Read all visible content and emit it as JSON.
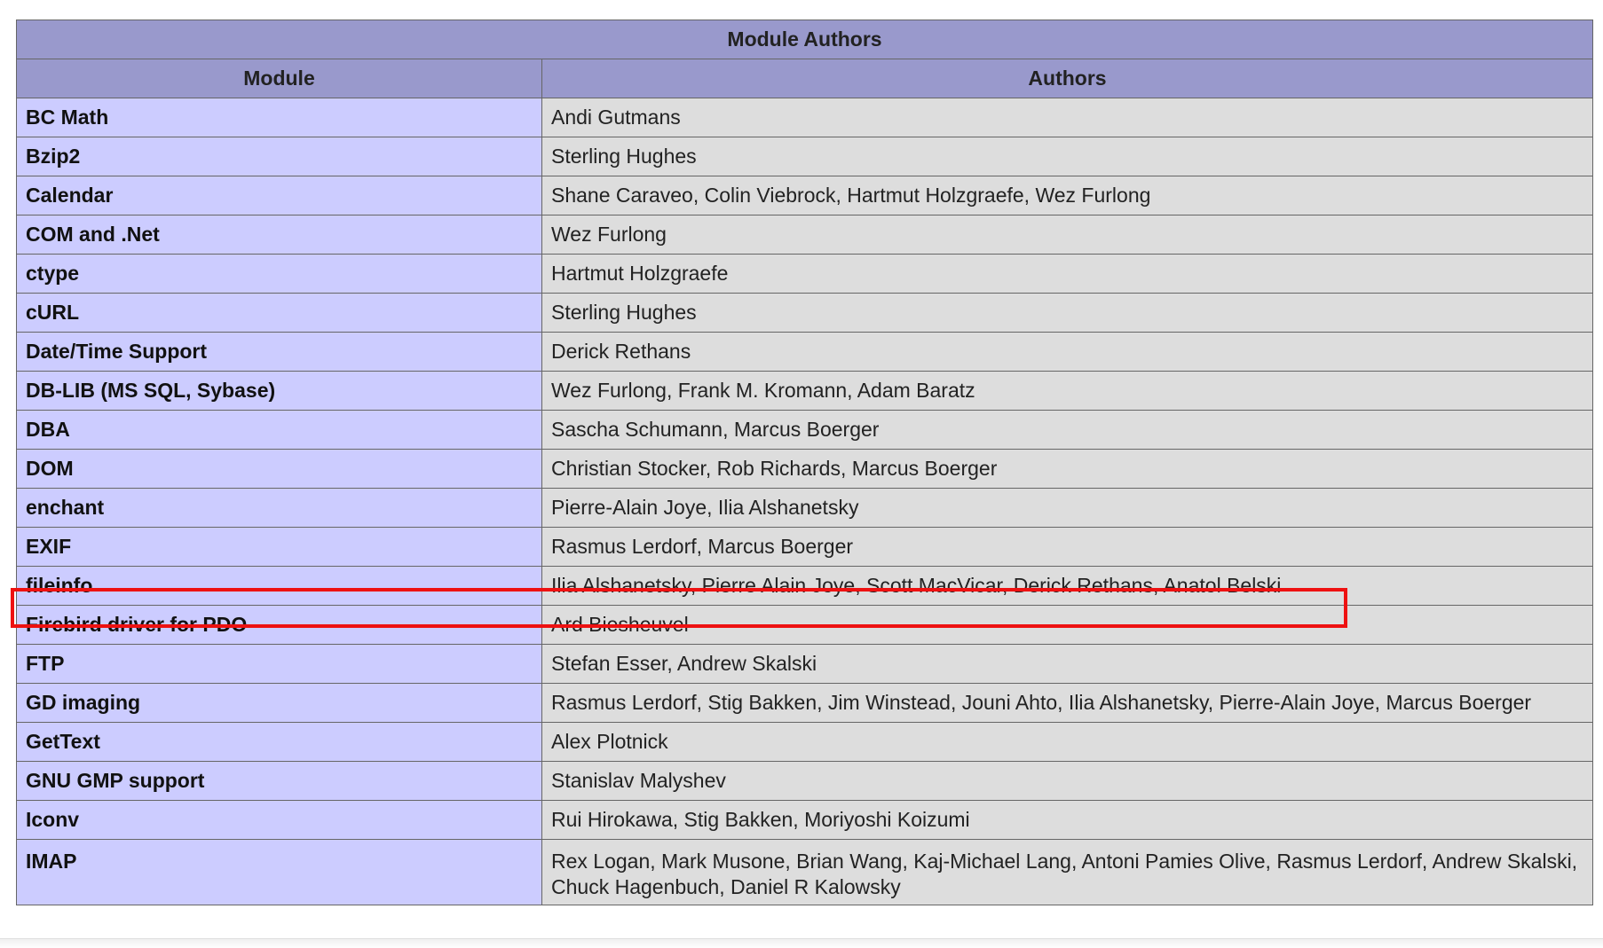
{
  "table": {
    "title": "Module Authors",
    "headers": [
      "Module",
      "Authors"
    ],
    "rows": [
      {
        "module": "BC Math",
        "authors": "Andi Gutmans"
      },
      {
        "module": "Bzip2",
        "authors": "Sterling Hughes"
      },
      {
        "module": "Calendar",
        "authors": "Shane Caraveo, Colin Viebrock, Hartmut Holzgraefe, Wez Furlong"
      },
      {
        "module": "COM and .Net",
        "authors": "Wez Furlong"
      },
      {
        "module": "ctype",
        "authors": "Hartmut Holzgraefe"
      },
      {
        "module": "cURL",
        "authors": "Sterling Hughes"
      },
      {
        "module": "Date/Time Support",
        "authors": "Derick Rethans"
      },
      {
        "module": "DB-LIB (MS SQL, Sybase)",
        "authors": "Wez Furlong, Frank M. Kromann, Adam Baratz"
      },
      {
        "module": "DBA",
        "authors": "Sascha Schumann, Marcus Boerger"
      },
      {
        "module": "DOM",
        "authors": "Christian Stocker, Rob Richards, Marcus Boerger"
      },
      {
        "module": "enchant",
        "authors": "Pierre-Alain Joye, Ilia Alshanetsky"
      },
      {
        "module": "EXIF",
        "authors": "Rasmus Lerdorf, Marcus Boerger"
      },
      {
        "module": "fileinfo",
        "authors": "Ilia Alshanetsky, Pierre Alain Joye, Scott MacVicar, Derick Rethans, Anatol Belski"
      },
      {
        "module": "Firebird driver for PDO",
        "authors": "Ard Biesheuvel"
      },
      {
        "module": "FTP",
        "authors": "Stefan Esser, Andrew Skalski"
      },
      {
        "module": "GD imaging",
        "authors": "Rasmus Lerdorf, Stig Bakken, Jim Winstead, Jouni Ahto, Ilia Alshanetsky, Pierre-Alain Joye, Marcus Boerger"
      },
      {
        "module": "GetText",
        "authors": "Alex Plotnick"
      },
      {
        "module": "GNU GMP support",
        "authors": "Stanislav Malyshev"
      },
      {
        "module": "Iconv",
        "authors": "Rui Hirokawa, Stig Bakken, Moriyoshi Koizumi"
      },
      {
        "module": "IMAP",
        "authors": "Rex Logan, Mark Musone, Brian Wang, Kaj-Michael Lang, Antoni Pamies Olive, Rasmus Lerdorf, Andrew Skalski, Chuck Hagenbuch, Daniel R Kalowsky"
      }
    ]
  },
  "colors": {
    "header_bg": "#9999cc",
    "module_bg": "#ccccff",
    "author_bg": "#dddddd",
    "highlight": "#ee1111"
  }
}
